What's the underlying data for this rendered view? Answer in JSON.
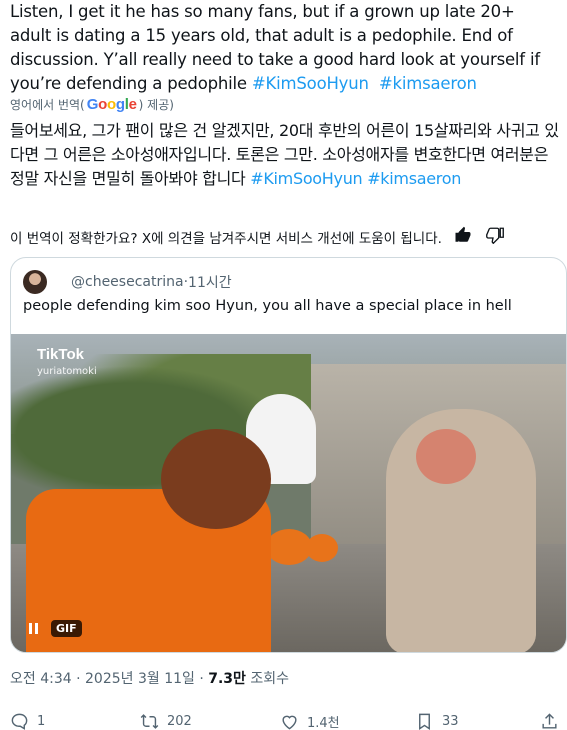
{
  "tweet": {
    "text_before": "Listen, I get it he has so many fans, but if a grown up late 20+ adult is dating a 15 years old, that adult is a pedophile. End of discussion.  Y’all really need to take a good hard look at yourself if you’re defending a pedophile ",
    "hashtag1": "#KimSooHyun",
    "hashtag2": "#kimsaeron"
  },
  "translation": {
    "by_prefix": "영어에서 번역(",
    "by_suffix": ") 제공)",
    "google_word": "Google",
    "text": "들어보세요, 그가 팬이 많은 건 알겠지만, 20대 후반의 어른이 15살짜리와 사귀고 있다면 그 어른은 소아성애자입니다. 토론은 그만. 소아성애자를 변호한다면 여러분은 정말 자신을 면밀히 돌아봐야 합니다 ",
    "hashtag1": "#KimSooHyun",
    "hashtag2": "#kimsaeron"
  },
  "feedback": {
    "question": "이 번역이 정확한가요? X에 의견을 남겨주시면 서비스 개선에 도움이 됩니다."
  },
  "quote": {
    "handle": "@cheesecatrina",
    "separator": " · ",
    "time": "11시간",
    "text": "people defending kim soo Hyun, you all have a special place in hell",
    "media": {
      "watermark": "TikTok",
      "watermark_user": "yuriatomoki",
      "badge": "GIF"
    }
  },
  "meta": {
    "time": "오전 4:34 · 2025년 3월 11일 · ",
    "views_count": "7.3만",
    "views_label": " 조회수"
  },
  "actions": {
    "replies": "1",
    "reposts": "202",
    "likes": "1.4천",
    "bookmarks": "33"
  },
  "colors": {
    "accent": "#1d9bf0",
    "text": "#0f1419",
    "secondary": "#536471",
    "border": "#cfd9de"
  }
}
